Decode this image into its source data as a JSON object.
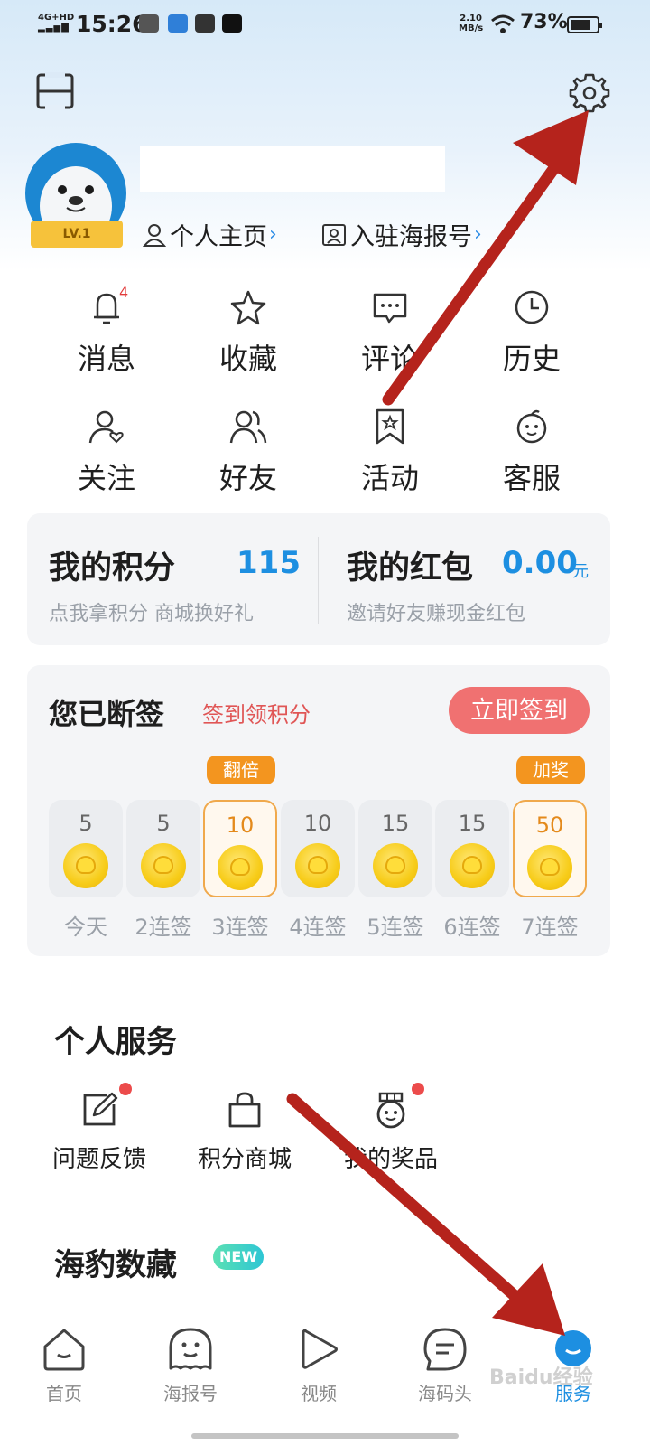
{
  "status_bar": {
    "time": "15:26",
    "network": "4G+HD",
    "speed_value": "2.10",
    "speed_unit": "MB/s",
    "battery": "73%"
  },
  "profile": {
    "level": "LV.1",
    "home_link": "个人主页",
    "join_link": "入驻海报号"
  },
  "quick_grid": [
    {
      "label": "消息",
      "icon": "bell-icon",
      "badge": "4"
    },
    {
      "label": "收藏",
      "icon": "star-icon"
    },
    {
      "label": "评论",
      "icon": "comment-icon"
    },
    {
      "label": "历史",
      "icon": "clock-icon"
    },
    {
      "label": "关注",
      "icon": "follow-user-icon"
    },
    {
      "label": "好友",
      "icon": "friends-icon"
    },
    {
      "label": "活动",
      "icon": "activity-bookmark-icon"
    },
    {
      "label": "客服",
      "icon": "customer-service-icon"
    }
  ],
  "points": {
    "title": "我的积分",
    "value": "115",
    "subtitle": "点我拿积分 商城换好礼"
  },
  "red_packet": {
    "title": "我的红包",
    "value": "0.00",
    "unit": "元",
    "subtitle": "邀请好友赚现金红包"
  },
  "sign_in": {
    "title": "您已断签",
    "subtitle": "签到领积分",
    "button": "立即签到",
    "days": [
      {
        "value": "5",
        "label": "今天",
        "tag": "",
        "highlight": false
      },
      {
        "value": "5",
        "label": "2连签",
        "tag": "",
        "highlight": false
      },
      {
        "value": "10",
        "label": "3连签",
        "tag": "翻倍",
        "highlight": true
      },
      {
        "value": "10",
        "label": "4连签",
        "tag": "",
        "highlight": false
      },
      {
        "value": "15",
        "label": "5连签",
        "tag": "",
        "highlight": false
      },
      {
        "value": "15",
        "label": "6连签",
        "tag": "",
        "highlight": false
      },
      {
        "value": "50",
        "label": "7连签",
        "tag": "加奖",
        "highlight": true
      }
    ]
  },
  "personal_service": {
    "title": "个人服务",
    "items": [
      {
        "label": "问题反馈",
        "icon": "feedback-edit-icon",
        "dot": true
      },
      {
        "label": "积分商城",
        "icon": "shopping-bag-icon",
        "dot": false
      },
      {
        "label": "我的奖品",
        "icon": "prize-medal-icon",
        "dot": true
      }
    ]
  },
  "digital_collection": {
    "title": "海豹数藏",
    "badge": "NEW"
  },
  "tab_bar": [
    {
      "label": "首页",
      "icon": "home-icon",
      "active": false
    },
    {
      "label": "海报号",
      "icon": "poster-face-icon",
      "active": false
    },
    {
      "label": "视频",
      "icon": "play-icon",
      "active": false
    },
    {
      "label": "海码头",
      "icon": "chat-bubble-icon",
      "active": false
    },
    {
      "label": "服务",
      "icon": "service-smile-icon",
      "active": true
    }
  ],
  "watermark": "Baidu经验",
  "colors": {
    "accent_blue": "#1d8fe1",
    "sign_button": "#f07171",
    "tag_orange": "#f3951f",
    "annotation_arrow": "#b5231c"
  }
}
